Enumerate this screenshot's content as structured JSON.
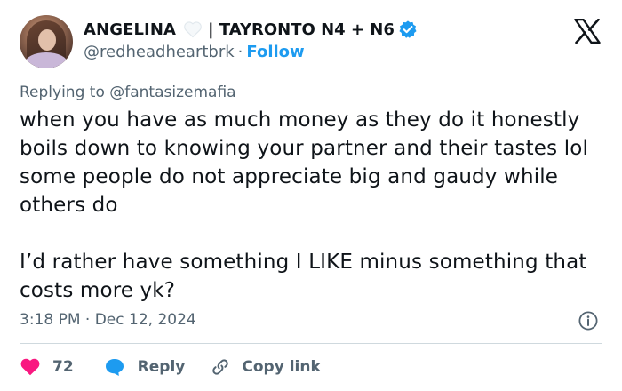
{
  "author": {
    "display_name": "ANGELINA​​",
    "display_name_suffix": "| TAYRONTO N4 + N6",
    "handle": "@redheadheartbrk",
    "separator": "·",
    "follow_label": "Follow",
    "verified": true,
    "heart_icon": "white-heart-icon",
    "accent_color": "#1d9bf0"
  },
  "reply_to": {
    "prefix": "Replying to",
    "mention": "@fantasizemafia"
  },
  "tweet": {
    "paragraphs": [
      "when you have as much money as they do it honestly boils down to knowing your partner and their tastes lol some people do not appreciate big and gaudy while others do",
      "I’d rather have something I LIKE minus something that costs more yk?"
    ]
  },
  "meta": {
    "timestamp": "3:18 PM · Dec 12, 2024"
  },
  "actions": {
    "like_count": "72",
    "reply_label": "Reply",
    "copy_link_label": "Copy link",
    "like_color": "#f91880",
    "reply_color": "#1d9bf0"
  }
}
